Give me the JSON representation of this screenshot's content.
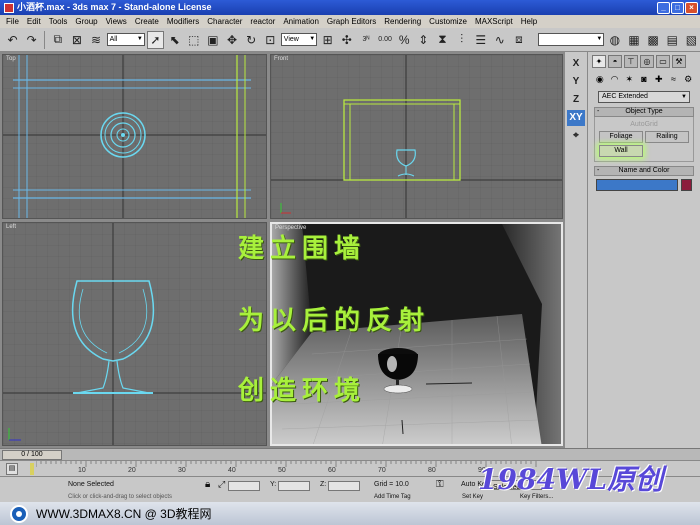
{
  "window": {
    "title": "小酒杯.max - 3ds max 7 - Stand-alone License"
  },
  "menu": [
    "File",
    "Edit",
    "Tools",
    "Group",
    "Views",
    "Create",
    "Modifiers",
    "Character",
    "reactor",
    "Animation",
    "Graph Editors",
    "Rendering",
    "Customize",
    "MAXScript",
    "Help"
  ],
  "toolbar": {
    "selection_filter": "All",
    "reference_coord": "View",
    "snap_value": "0.00"
  },
  "viewports": {
    "top": "Top",
    "front": "Front",
    "left": "Left",
    "perspective": "Perspective"
  },
  "axis_constraints": [
    "X",
    "Y",
    "Z",
    "XY"
  ],
  "command_panel": {
    "category": "AEC Extended",
    "object_type_title": "Object Type",
    "autogrid": "AutoGrid",
    "buttons": [
      "Foliage",
      "Railing",
      "Wall"
    ],
    "name_color_title": "Name and Color",
    "accent": "#3c78c8",
    "swatch_color": "#8c1c3c"
  },
  "timeline": {
    "frame_display": "0 / 100",
    "ticks": [
      "0",
      "10",
      "20",
      "30",
      "40",
      "50",
      "60",
      "70",
      "80",
      "90"
    ]
  },
  "status": {
    "selection": "None Selected",
    "prompt": "Click or click-and-drag to select objects",
    "x_label": "X:",
    "y_label": "Y:",
    "z_label": "Z:",
    "grid": "Grid = 10.0",
    "auto_key": "Auto Key",
    "selected": "Selected",
    "set_key": "Set Key",
    "key_filters": "Key Filters...",
    "add_time_tag": "Add Time Tag"
  },
  "captions": [
    "建立围墙",
    "为以后的反射",
    "创造环境"
  ],
  "signature": "1984WL原创",
  "footer": {
    "site": "WWW.3DMAX8.CN @ 3D教程网"
  }
}
